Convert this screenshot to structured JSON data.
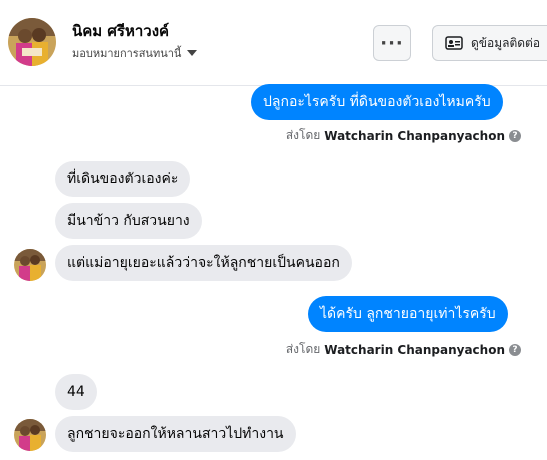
{
  "header": {
    "contact_name": "นิคม ศรีหาวงค์",
    "assign_label": "มอบหมายการสนทนานี้",
    "more_label": "···",
    "contact_info_label": "ดูข้อมูลติดต่อ"
  },
  "conversation": {
    "sent_by_prefix": "ส่งโดย",
    "sender_name": "Watcharin Chanpanyachon",
    "info_symbol": "?",
    "messages": [
      {
        "direction": "outgoing",
        "text": "ปลูกอะไรครับ ที่ดินของตัวเองไหมครับ"
      },
      {
        "direction": "incoming",
        "text": "ที่เดินของตัวเองค่ะ"
      },
      {
        "direction": "incoming",
        "text": "มีนาข้าว กับสวนยาง"
      },
      {
        "direction": "incoming",
        "text": "แต่แม่อายุเยอะแล้วว่าจะให้ลูกชายเป็นคนออก"
      },
      {
        "direction": "outgoing",
        "text": "ได้ครับ ลูกชายอายุเท่าไรครับ"
      },
      {
        "direction": "incoming",
        "text": "44"
      },
      {
        "direction": "incoming",
        "text": "ลูกชายจะออกให้หลานสาวไปทำงาน"
      }
    ]
  },
  "colors": {
    "outgoing_bubble": "#0084ff",
    "incoming_bubble": "#e9eaee"
  }
}
